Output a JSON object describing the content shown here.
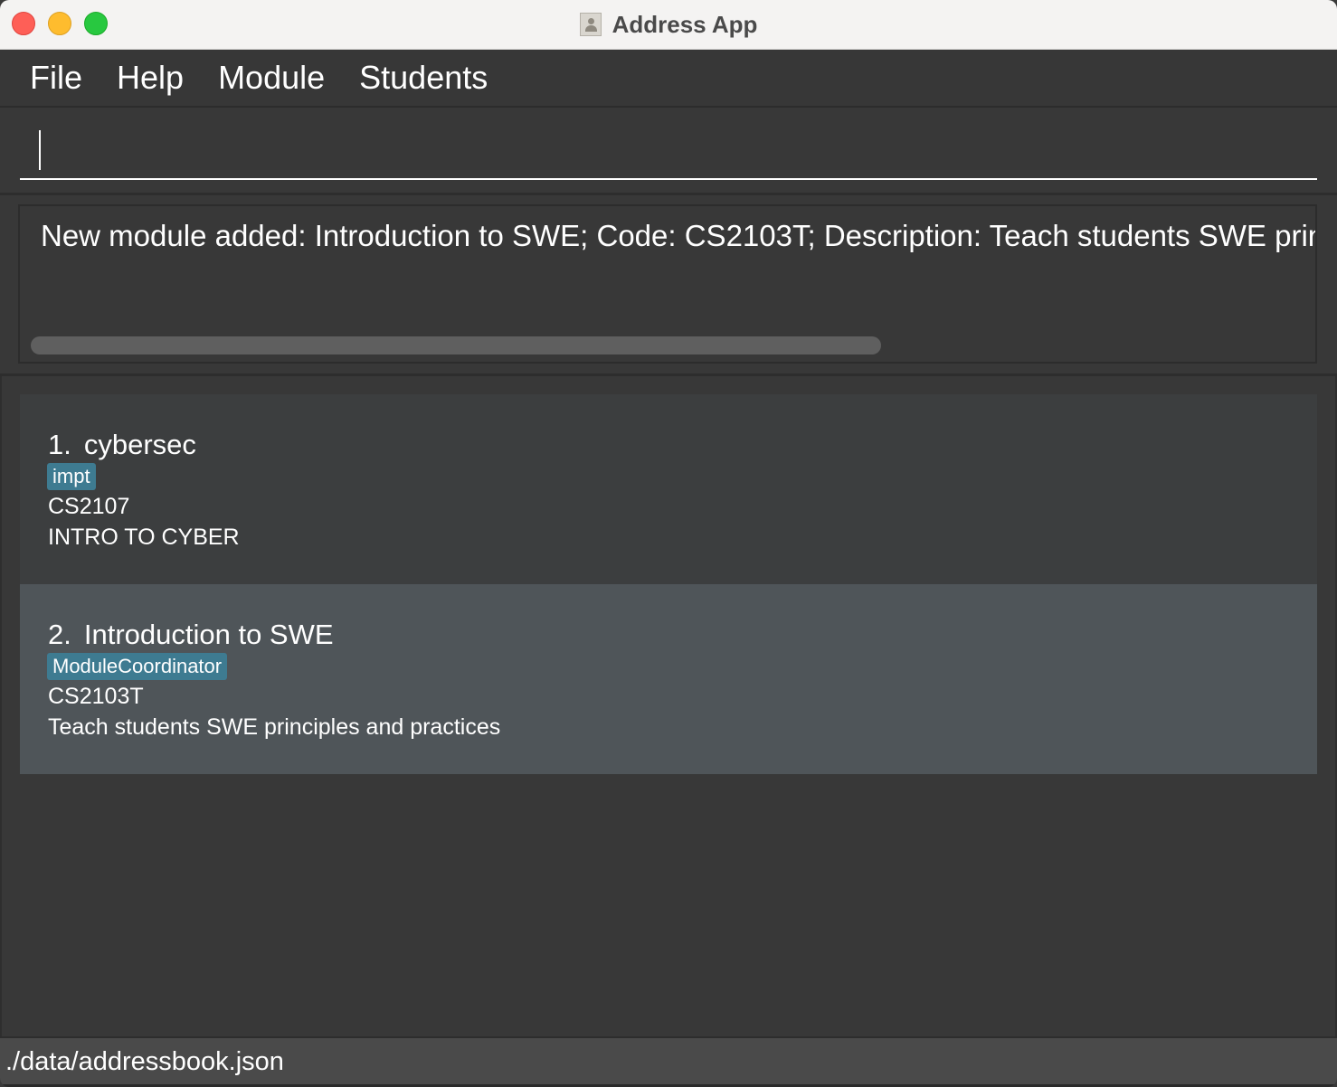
{
  "window": {
    "title": "Address App"
  },
  "menu": {
    "items": [
      {
        "label": "File"
      },
      {
        "label": "Help"
      },
      {
        "label": "Module"
      },
      {
        "label": "Students"
      }
    ]
  },
  "command": {
    "value": "",
    "placeholder": ""
  },
  "result": {
    "message": "New module added: Introduction to SWE; Code: CS2103T; Description: Teach students SWE principles and practices"
  },
  "modules": [
    {
      "index": "1.",
      "name": "cybersec",
      "tag": "impt",
      "code": "CS2107",
      "description": "INTRO TO CYBER"
    },
    {
      "index": "2.",
      "name": "Introduction to SWE",
      "tag": "ModuleCoordinator",
      "code": "CS2103T",
      "description": "Teach students SWE principles and practices"
    }
  ],
  "status": {
    "file_path": "./data/addressbook.json"
  },
  "colors": {
    "background": "#383838",
    "card_default": "#3c3e3f",
    "card_selected": "#4f5559",
    "tag": "#3e7b91",
    "traffic_close": "#fe5f57",
    "traffic_minimize": "#febc2e",
    "traffic_maximize": "#28c840"
  }
}
